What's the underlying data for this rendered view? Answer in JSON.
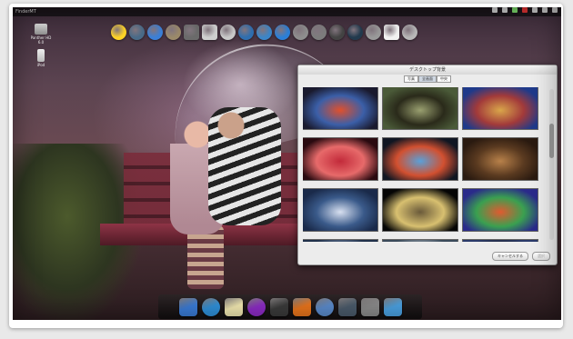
{
  "menubar": {
    "app_name": "FinderMT",
    "status_icons": [
      "bluetooth-icon",
      "wifi-icon",
      "battery-icon",
      "clock-icon",
      "user-icon",
      "spotlight-icon",
      "list-icon"
    ]
  },
  "desktop_icons": [
    {
      "name": "hard-drive-icon",
      "label": "Panther HD 6.0"
    },
    {
      "name": "ipod-icon",
      "label": "iPod"
    }
  ],
  "top_dock_icons": [
    {
      "name": "star-icon",
      "color": "#ffd327"
    },
    {
      "name": "globe-icon",
      "color": "#4a6b88"
    },
    {
      "name": "finder-icon",
      "color": "#3b80d8"
    },
    {
      "name": "toolbox-icon",
      "color": "#9b8a6a"
    },
    {
      "name": "calculator-icon",
      "color": "#6b6b6b"
    },
    {
      "name": "document-icon",
      "color": "#cfcfcf"
    },
    {
      "name": "cd-icon",
      "color": "#c9c9c9"
    },
    {
      "name": "compass-icon",
      "color": "#2f6fb0"
    },
    {
      "name": "chat-icon",
      "color": "#3c86c8"
    },
    {
      "name": "info-icon",
      "color": "#2b7fd8"
    },
    {
      "name": "crank-icon",
      "color": "#8e8e8e"
    },
    {
      "name": "gears-icon",
      "color": "#7d7d7d"
    },
    {
      "name": "circle-icon",
      "color": "#444444"
    },
    {
      "name": "disc-icon",
      "color": "#223a4e"
    },
    {
      "name": "trash-icon",
      "color": "#9a9a9a"
    },
    {
      "name": "photo-icon",
      "color": "#f2f2f2"
    },
    {
      "name": "speaker-icon",
      "color": "#b8b8b8"
    }
  ],
  "window": {
    "title": "デスクトップ背景",
    "segments": [
      "写真",
      "全画面",
      "中央"
    ],
    "active_segment": 1,
    "thumbnails": [
      [
        "#1a1a2e",
        "#e0502c",
        "#3b5fa8"
      ],
      [
        "#4a5a38",
        "#9aa070",
        "#2a2a1a"
      ],
      [
        "#1f3a8a",
        "#d9a64a",
        "#a23a3a"
      ],
      [
        "#2a0a10",
        "#c22a3a",
        "#e76a6a"
      ],
      [
        "#101622",
        "#5aa0d8",
        "#d25030"
      ],
      [
        "#2a1a10",
        "#b8814a",
        "#5a3a20"
      ],
      [
        "#1a2a4a",
        "#d8e0f0",
        "#3a5a8a"
      ],
      [
        "#050505",
        "#6a5a3a",
        "#d8c070"
      ],
      [
        "#2a2a8a",
        "#e05a30",
        "#3aa050"
      ],
      [
        "#20304a",
        "#e09050",
        "#8aa0c0"
      ],
      [
        "#3a4a5a",
        "#7a8a9a",
        "#c0c8d0"
      ],
      [
        "#2a3a6a",
        "#e8eef8",
        "#1a1a1a"
      ]
    ],
    "ok_button": "キャンセルする",
    "disabled_button": "選択"
  },
  "dock_icons": [
    {
      "name": "finder-icon",
      "color": "#3a7bd5"
    },
    {
      "name": "safari-icon",
      "color": "#2f8fd8"
    },
    {
      "name": "notes-icon",
      "color": "#f1e7b0"
    },
    {
      "name": "itunes-icon",
      "color": "#8c2bc4"
    },
    {
      "name": "facetime-icon",
      "color": "#3a3a3a"
    },
    {
      "name": "firefox-icon",
      "color": "#e8741c"
    },
    {
      "name": "system-icon",
      "color": "#5a8acb"
    },
    {
      "name": "launcher-icon",
      "color": "#4a5a6a"
    },
    {
      "name": "preferences-icon",
      "color": "#8a8a8a"
    },
    {
      "name": "folder-icon",
      "color": "#4aa0e0"
    }
  ]
}
